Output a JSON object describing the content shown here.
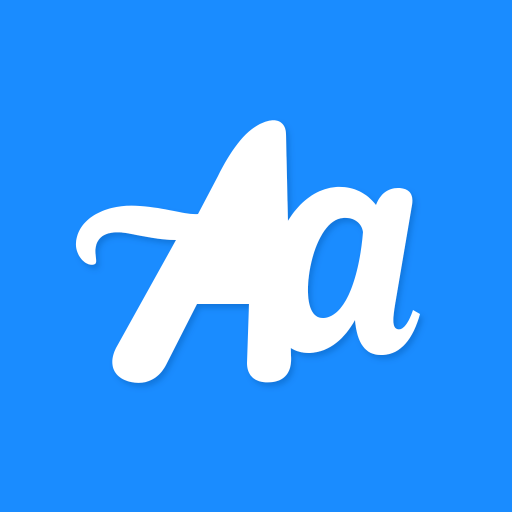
{
  "icon": {
    "name": "font-app-icon",
    "logo_text": "Aa",
    "colors": {
      "background": "#1a8cff",
      "glyph": "#ffffff",
      "shadow": "#0a4fa0"
    }
  }
}
